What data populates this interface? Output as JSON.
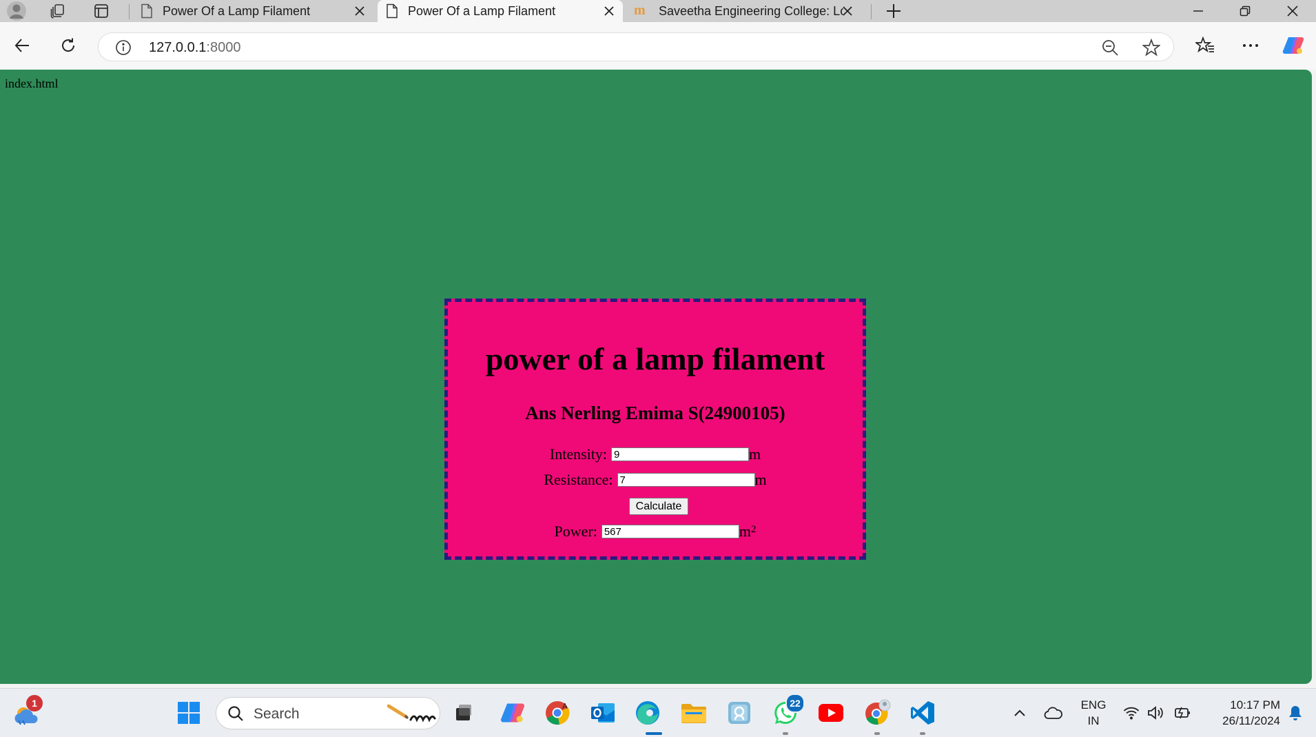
{
  "browser": {
    "tabs": [
      {
        "title": "Power Of a Lamp Filament",
        "icon": "page-icon"
      },
      {
        "title": "Power Of a Lamp Filament",
        "icon": "page-icon"
      },
      {
        "title": "Saveetha Engineering College: Lo",
        "icon": "moodle-icon"
      }
    ],
    "address": {
      "host": "127.0.0.1",
      "port": ":8000"
    }
  },
  "page": {
    "file_label": "index.html",
    "title": "power of a lamp filament",
    "author": "Ans Nerling Emima S(24900105)",
    "intensity": {
      "label": "Intensity:",
      "value": "9",
      "unit": "m"
    },
    "resistance": {
      "label": "Resistance:",
      "value": "7",
      "unit": "m"
    },
    "calculate_label": "Calculate",
    "power": {
      "label": "Power:",
      "value": "567",
      "unit": "m",
      "unit_exp": "2"
    }
  },
  "taskbar": {
    "weather_badge": "1",
    "search_label": "Search",
    "whatsapp_badge": "22",
    "lang": "ENG",
    "region": "IN",
    "time": "10:17 PM",
    "date": "26/11/2024"
  },
  "colors": {
    "page_bg": "#2e8b57",
    "card_bg": "#f00a78",
    "card_border": "#2c1a7d"
  }
}
